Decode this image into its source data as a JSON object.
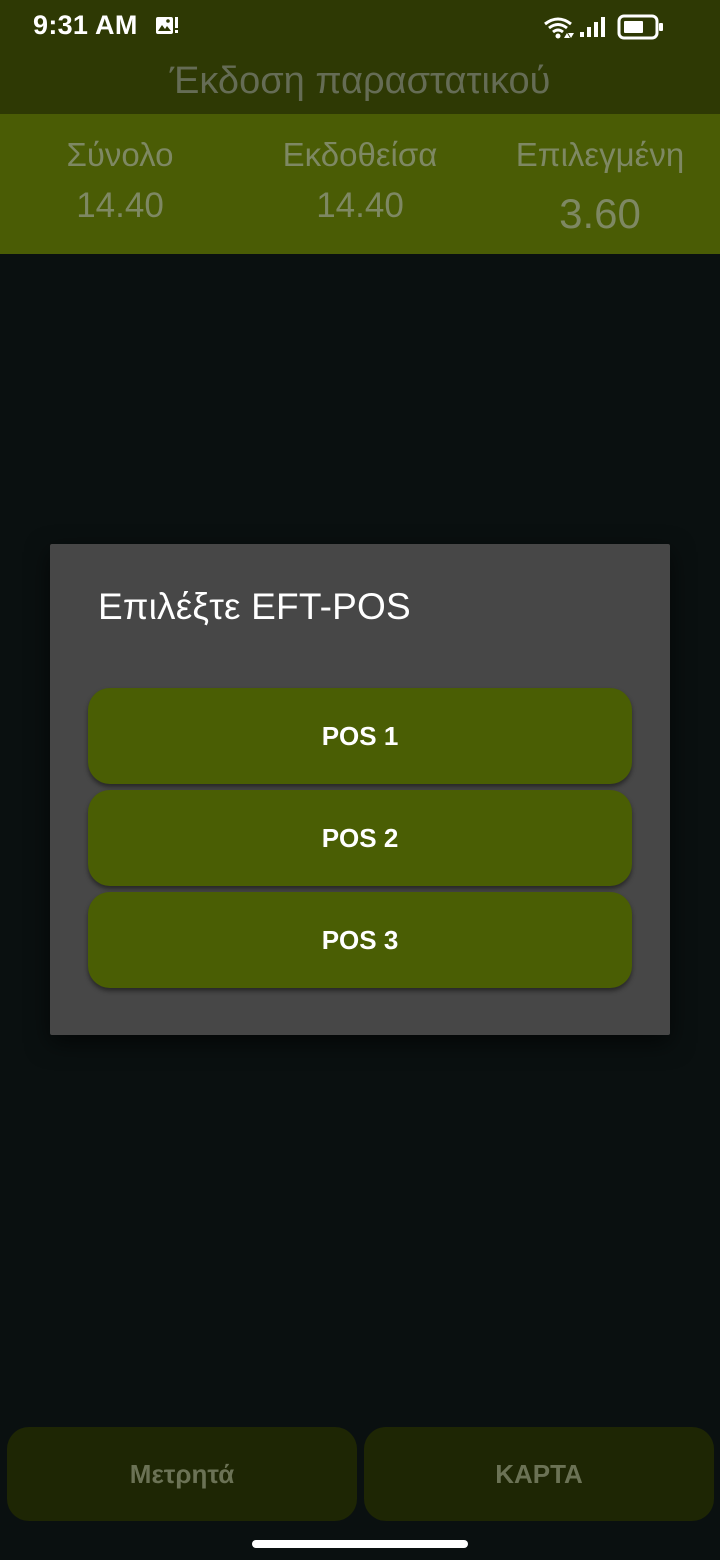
{
  "status_bar": {
    "time": "9:31 AM",
    "icons": [
      "gallery-alert-icon",
      "wifi-icon",
      "signal-icon",
      "battery-icon"
    ]
  },
  "app_bar": {
    "title": "Έκδοση παραστατικού"
  },
  "totals": [
    {
      "label": "Σύνολο",
      "value": "14.40"
    },
    {
      "label": "Εκδοθείσα",
      "value": "14.40"
    },
    {
      "label": "Επιλεγμένη",
      "value": "3.60"
    }
  ],
  "dialog": {
    "title": "Επιλέξτε EFT-POS",
    "options": [
      "POS 1",
      "POS 2",
      "POS 3"
    ]
  },
  "bottom_buttons": {
    "cash": "Μετρητά",
    "card": "ΚΑΡΤΑ"
  },
  "colors": {
    "status_bar_bg": "#2e3904",
    "totals_bg": "#4a5c05",
    "dialog_bg": "#474747",
    "button_green": "#4a5e04",
    "screen_bg": "#0a1010"
  }
}
